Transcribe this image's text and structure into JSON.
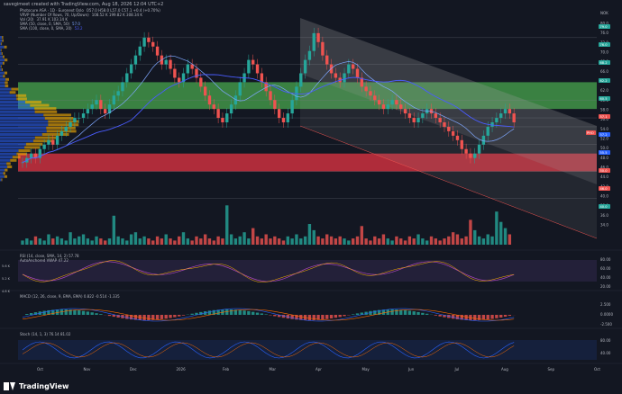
{
  "header": {
    "credit": "savegimeet created with TradingView.com, Aug 18, 2026 12:04 UTC+2"
  },
  "main_legend": [
    {
      "text": "Photocure ASA · 1D · Euronext Oslo",
      "values": "O57.0 H58.0 L57.0 C57.1 +0.4 (+0.70%)",
      "color": "#b2b5be"
    },
    {
      "text": "VRVP (Number Of Rows, 70, Up/Down)",
      "values": "108.52 K  199.82 K  308.34 K",
      "color": "#b2b5be"
    },
    {
      "text": "Vol (20)",
      "values": "37.91 K  103.14 K",
      "color": "#b2b5be"
    },
    {
      "text": "SMA (50, close, 0, SMA, 50)",
      "values": "57.0",
      "color": "#7fa7ff"
    },
    {
      "text": "SMA (100, close, 0, SMA, 20)",
      "values": "53.2",
      "color": "#4a5cff"
    }
  ],
  "price_axis": [
    "80.0",
    "76.0",
    "72.0",
    "70.0",
    "68.0",
    "66.0",
    "64.0",
    "62.0",
    "60.0",
    "58.0",
    "56.0",
    "54.0",
    "52.0",
    "50.0",
    "48.0",
    "46.0",
    "44.0",
    "42.0",
    "40.0",
    "38.0",
    "36.0",
    "34.0"
  ],
  "price_axis_top": "NOK",
  "tags": [
    {
      "label": "79.0",
      "color": "#26a69a"
    },
    {
      "label": "76.0",
      "color": "#26a69a"
    },
    {
      "label": "68.2",
      "color": "#26a69a"
    },
    {
      "label": "62.2",
      "color": "#26a69a"
    },
    {
      "label": "60.5",
      "color": "#26a69a"
    },
    {
      "label": "57.1",
      "color": "#ef5350"
    },
    {
      "label": "57.2",
      "color": "#2962ff"
    },
    {
      "label": "55.5",
      "color": "#2962ff"
    },
    {
      "label": "50.0",
      "color": "#ef5350"
    },
    {
      "label": "46.0",
      "color": "#ef5350"
    },
    {
      "label": "40.0",
      "color": "#26a69a"
    }
  ],
  "sym_tag": "PHO",
  "rsi_legend": "RSI (14, close, SMA, 14, 2)  57.78",
  "rsi_sub": "AutoAnchored VWAP 47.22",
  "rsi_axis": [
    "80.00",
    "60.00",
    "40.00",
    "20.00"
  ],
  "left_scale": [
    "5.6 K",
    "5.2 K",
    "4.8 K"
  ],
  "macd_legend": "MACD (12, 26, close, 9, EMA, EMA)  0.822  -0.514  -1.335",
  "macd_axis": [
    "2.500",
    "0.0000",
    "-2.500"
  ],
  "stoch_legend": "Stoch (14, 1, 3)  76.14  81.02",
  "stoch_axis": [
    "80.00",
    "40.00"
  ],
  "time_axis": [
    "Oct",
    "Nov",
    "Dec",
    "2026",
    "Feb",
    "Mar",
    "Apr",
    "May",
    "Jun",
    "Jul",
    "Aug",
    "Sep",
    "Oct"
  ],
  "footer": {
    "brand": "TradingView"
  },
  "chart_data": {
    "type": "candlestick",
    "price_range": [
      34,
      80
    ],
    "zones": [
      {
        "from": 60,
        "to": 66,
        "color": "#4caf50"
      },
      {
        "from": 46,
        "to": 50,
        "color": "#f23645"
      }
    ],
    "closes": [
      48,
      49,
      50,
      49,
      51,
      52,
      53,
      52,
      54,
      55,
      56,
      57,
      58,
      58,
      59,
      60,
      61,
      62,
      60,
      59,
      61,
      63,
      64,
      66,
      68,
      70,
      72,
      74,
      76,
      75,
      74,
      72,
      70,
      71,
      69,
      67,
      66,
      68,
      70,
      69,
      67,
      65,
      63,
      61,
      60,
      58,
      57,
      59,
      61,
      63,
      66,
      68,
      71,
      70,
      68,
      66,
      64,
      62,
      60,
      58,
      57,
      59,
      62,
      65,
      68,
      71,
      73,
      77,
      75,
      72,
      70,
      68,
      67,
      66,
      68,
      70,
      69,
      67,
      65,
      64,
      63,
      62,
      61,
      60,
      61,
      62,
      61,
      60,
      59,
      58,
      57,
      58,
      59,
      60,
      59,
      58,
      57,
      56,
      55,
      54,
      53,
      51,
      50,
      49,
      50,
      52,
      54,
      56,
      57,
      58,
      59,
      60,
      59,
      57
    ],
    "volumes": [
      2,
      3,
      2,
      4,
      3,
      2,
      5,
      3,
      4,
      3,
      2,
      6,
      3,
      4,
      5,
      3,
      2,
      4,
      3,
      2,
      3,
      14,
      4,
      3,
      2,
      5,
      6,
      3,
      4,
      3,
      2,
      4,
      3,
      5,
      3,
      2,
      4,
      6,
      3,
      2,
      4,
      3,
      5,
      3,
      2,
      4,
      3,
      19,
      5,
      3,
      4,
      6,
      3,
      8,
      4,
      3,
      5,
      3,
      4,
      3,
      2,
      4,
      3,
      5,
      3,
      4,
      10,
      7,
      4,
      3,
      5,
      4,
      3,
      4,
      3,
      2,
      3,
      4,
      9,
      3,
      2,
      4,
      3,
      5,
      3,
      2,
      4,
      3,
      2,
      4,
      3,
      5,
      3,
      2,
      4,
      3,
      2,
      3,
      4,
      6,
      5,
      3,
      4,
      12,
      7,
      4,
      3,
      5,
      4,
      16,
      11,
      8,
      5
    ]
  }
}
